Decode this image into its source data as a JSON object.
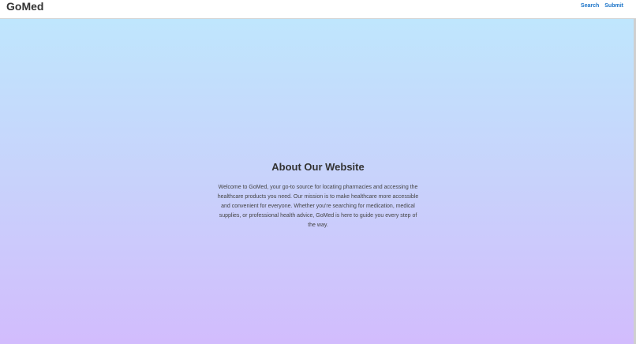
{
  "header": {
    "brand": "GoMed",
    "nav": [
      {
        "label": "Search"
      },
      {
        "label": "Submit"
      }
    ]
  },
  "about": {
    "title": "About Our Website",
    "body": "Welcome to GoMed, your go-to source for locating pharmacies and accessing the healthcare products you need. Our mission is to make healthcare more accessible and convenient for everyone. Whether you're searching for medication, medical supplies, or professional health advice, GoMed is here to guide you every step of the way."
  },
  "colors": {
    "brand_text": "#333333",
    "nav_link": "#1a73c8",
    "gradient_top": "#bfe6fd",
    "gradient_bottom": "#d2bcfd"
  }
}
